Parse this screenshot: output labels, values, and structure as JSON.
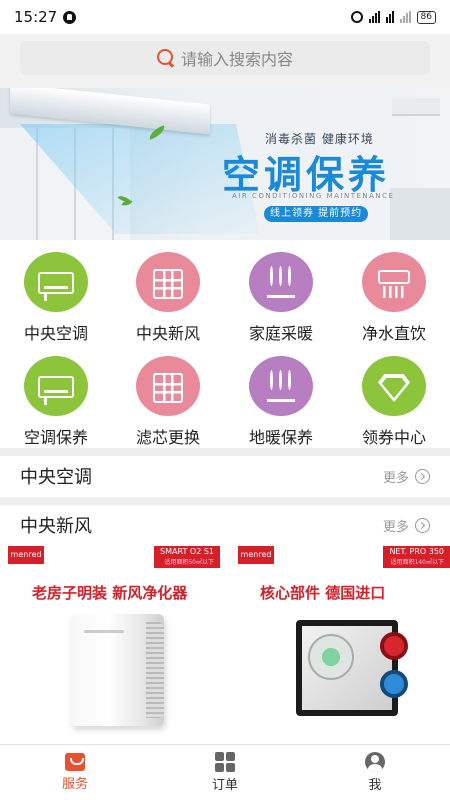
{
  "status_bar": {
    "time": "15:27",
    "battery": "86"
  },
  "search": {
    "placeholder": "请输入搜索内容"
  },
  "banner": {
    "tagline": "消毒杀菌 健康环境",
    "title": "空调保养",
    "subtitle_en": "AIR CONDITIONING MAINTENANCE",
    "pill": "线上领券 提前预约"
  },
  "categories": [
    {
      "label": "中央空调",
      "icon": "air-conditioner-icon",
      "color": "#8cc43c"
    },
    {
      "label": "中央新风",
      "icon": "fresh-air-grid-icon",
      "color": "#e88a99"
    },
    {
      "label": "家庭采暖",
      "icon": "heating-icon",
      "color": "#b77ec2"
    },
    {
      "label": "净水直饮",
      "icon": "water-purifier-icon",
      "color": "#e88a99"
    },
    {
      "label": "空调保养",
      "icon": "air-conditioner-icon",
      "color": "#8cc43c"
    },
    {
      "label": "滤芯更换",
      "icon": "filter-grid-icon",
      "color": "#e88a99"
    },
    {
      "label": "地暖保养",
      "icon": "floor-heating-icon",
      "color": "#b77ec2"
    },
    {
      "label": "领券中心",
      "icon": "diamond-icon",
      "color": "#8cc43c"
    }
  ],
  "sections": [
    {
      "title": "中央空调",
      "more": "更多"
    },
    {
      "title": "中央新风",
      "more": "更多"
    }
  ],
  "products": [
    {
      "brand": "menred",
      "model": "SMART O2 S1",
      "model_sub": "适用面积50㎡以下",
      "headline": "老房子明装 新风净化器"
    },
    {
      "brand": "menred",
      "model": "NET. PRO 350",
      "model_sub": "适用面积140㎡以下",
      "headline": "核心部件 德国进口"
    }
  ],
  "bottom_nav": [
    {
      "label": "服务",
      "icon": "shopping-bag-icon",
      "active": true
    },
    {
      "label": "订单",
      "icon": "grid-apps-icon",
      "active": false
    },
    {
      "label": "我",
      "icon": "user-icon",
      "active": false
    }
  ],
  "colors": {
    "accent": "#e8502f",
    "brand_red": "#d5202a",
    "banner_blue": "#1a8ad8"
  }
}
